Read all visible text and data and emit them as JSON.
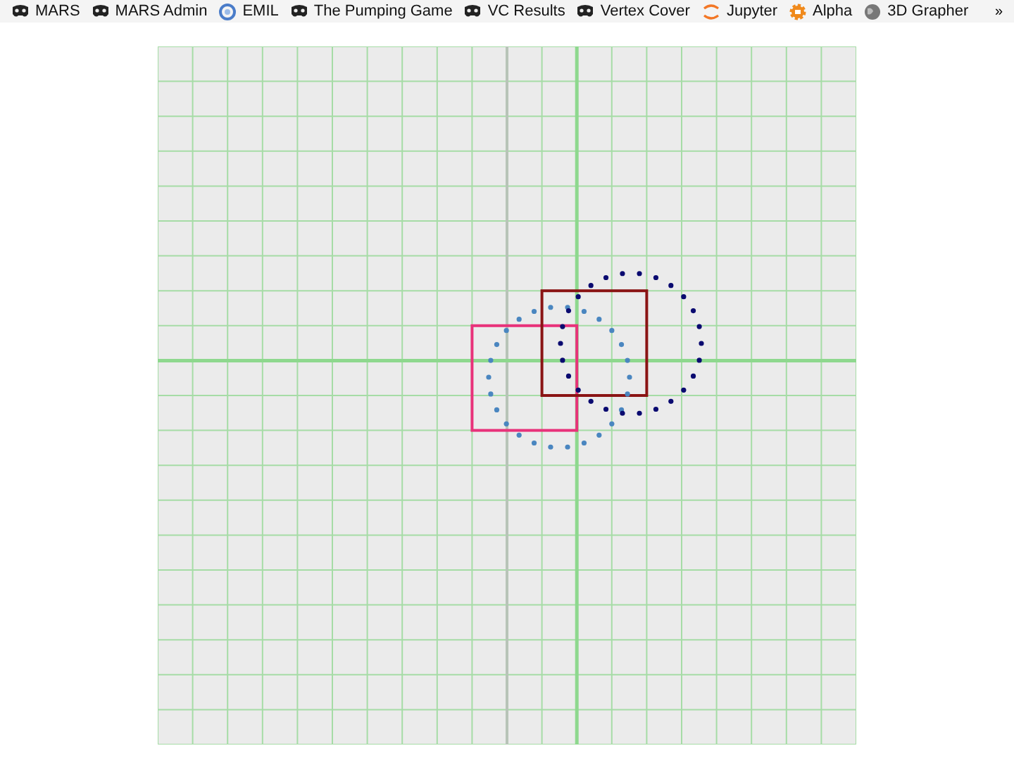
{
  "bookmarks_bar": {
    "items": [
      {
        "label": "MARS",
        "kind": "mask"
      },
      {
        "label": "MARS Admin",
        "kind": "mask"
      },
      {
        "label": "EMIL",
        "kind": "ring"
      },
      {
        "label": "The Pumping Game",
        "kind": "mask"
      },
      {
        "label": "VC Results",
        "kind": "mask"
      },
      {
        "label": "Vertex Cover",
        "kind": "mask"
      },
      {
        "label": "Jupyter",
        "kind": "arcs"
      },
      {
        "label": "Alpha",
        "kind": "gear"
      },
      {
        "label": "3D Grapher",
        "kind": "globe"
      }
    ],
    "overflow": "»"
  }
}
